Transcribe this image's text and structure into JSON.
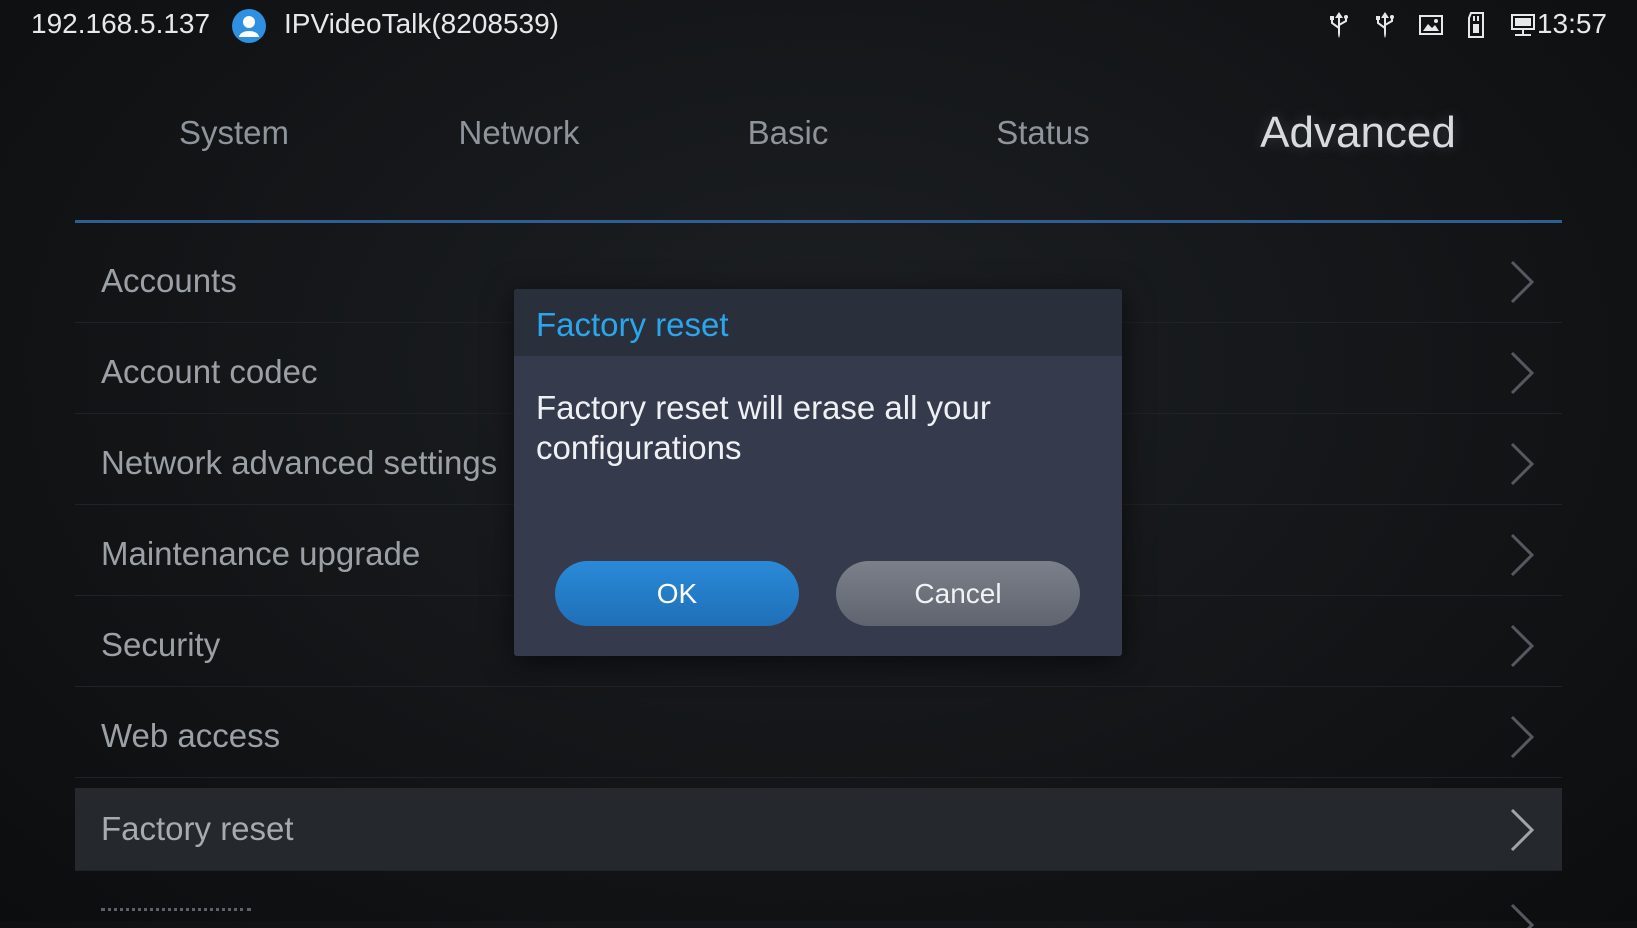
{
  "status_bar": {
    "ip": "192.168.5.137",
    "account": "IPVideoTalk(8208539)",
    "time": "13:57",
    "icons": [
      "usb-icon",
      "usb-icon",
      "image-icon",
      "sd-card-icon",
      "network-icon"
    ],
    "avatar_color": "#2f8fe0"
  },
  "tabs": [
    {
      "label": "System",
      "active": false
    },
    {
      "label": "Network",
      "active": false
    },
    {
      "label": "Basic",
      "active": false
    },
    {
      "label": "Status",
      "active": false
    },
    {
      "label": "Advanced",
      "active": true
    }
  ],
  "menu": {
    "items": [
      {
        "label": "Accounts"
      },
      {
        "label": "Account codec"
      },
      {
        "label": "Network advanced settings"
      },
      {
        "label": "Maintenance upgrade"
      },
      {
        "label": "Security"
      },
      {
        "label": "Web access"
      },
      {
        "label": "Factory reset",
        "selected": true
      }
    ]
  },
  "dialog": {
    "title": "Factory reset",
    "message": "Factory reset will erase all your configurations",
    "ok_label": "OK",
    "cancel_label": "Cancel",
    "title_color": "#29a6ec",
    "ok_color": "#2a8ad8"
  }
}
